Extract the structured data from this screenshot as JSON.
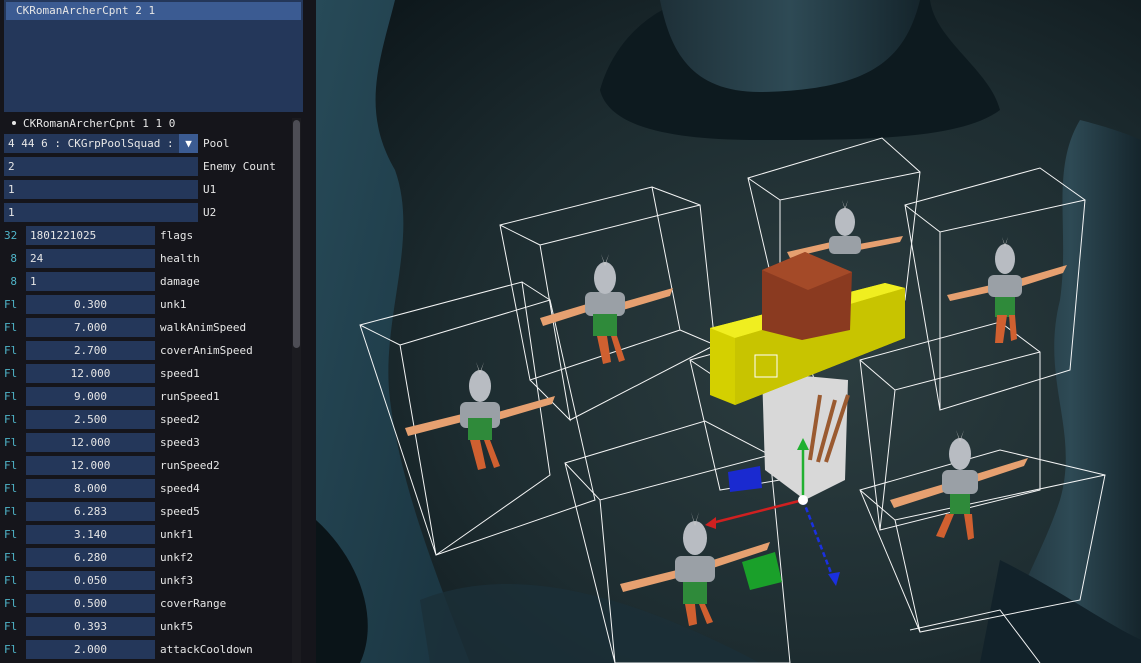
{
  "list": {
    "selected": "CKRomanArcherCpnt 2 1"
  },
  "tree": {
    "node": "CKRomanArcherCpnt 1 1 0"
  },
  "pool": {
    "value": "4 44 6 : CKGrpPoolSquad :",
    "arrow": "▼",
    "label": "Pool"
  },
  "enemy_count": {
    "value": "2",
    "label": "Enemy Count"
  },
  "u1": {
    "value": "1",
    "label": "U1"
  },
  "u2": {
    "value": "1",
    "label": "U2"
  },
  "int_fields": [
    {
      "type": "32",
      "value": "1801221025",
      "label": "flags"
    },
    {
      "type": "8",
      "value": "24",
      "label": "health"
    },
    {
      "type": "8",
      "value": "1",
      "label": "damage"
    }
  ],
  "float_fields": [
    {
      "type": "Fl",
      "value": "0.300",
      "label": "unk1"
    },
    {
      "type": "Fl",
      "value": "7.000",
      "label": "walkAnimSpeed"
    },
    {
      "type": "Fl",
      "value": "2.700",
      "label": "coverAnimSpeed"
    },
    {
      "type": "Fl",
      "value": "12.000",
      "label": "speed1"
    },
    {
      "type": "Fl",
      "value": "9.000",
      "label": "runSpeed1"
    },
    {
      "type": "Fl",
      "value": "2.500",
      "label": "speed2"
    },
    {
      "type": "Fl",
      "value": "12.000",
      "label": "speed3"
    },
    {
      "type": "Fl",
      "value": "12.000",
      "label": "runSpeed2"
    },
    {
      "type": "Fl",
      "value": "8.000",
      "label": "speed4"
    },
    {
      "type": "Fl",
      "value": "6.283",
      "label": "speed5"
    },
    {
      "type": "Fl",
      "value": "3.140",
      "label": "unkf1"
    },
    {
      "type": "Fl",
      "value": "6.280",
      "label": "unkf2"
    },
    {
      "type": "Fl",
      "value": "0.050",
      "label": "unkf3"
    },
    {
      "type": "Fl",
      "value": "0.500",
      "label": "coverRange"
    },
    {
      "type": "Fl",
      "value": "0.393",
      "label": "unkf5"
    },
    {
      "type": "Fl",
      "value": "2.000",
      "label": "attackCooldown"
    }
  ],
  "colors": {
    "widget_bg": "#24375a",
    "selected_bg": "#3b5b92",
    "panel_bg": "#15151b",
    "type_color": "#4fb4c8",
    "floor": "#1e2e33"
  }
}
